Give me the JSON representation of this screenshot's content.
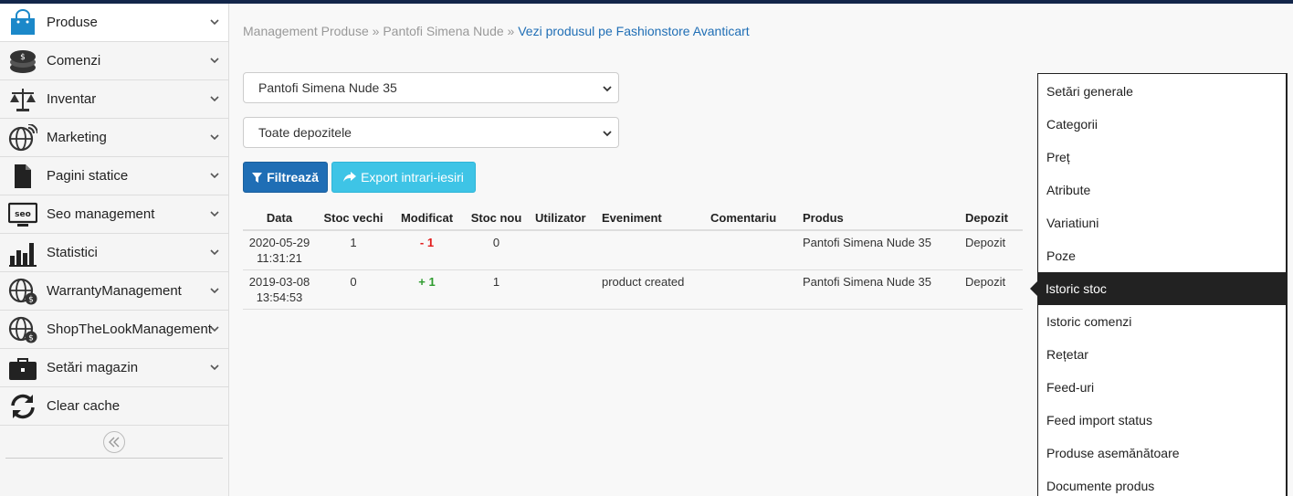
{
  "sidebar": {
    "items": [
      {
        "label": "Produse",
        "icon": "shopping-bag-icon",
        "active": true
      },
      {
        "label": "Comenzi",
        "icon": "coins-icon"
      },
      {
        "label": "Inventar",
        "icon": "scale-icon"
      },
      {
        "label": "Marketing",
        "icon": "globe-signal-icon"
      },
      {
        "label": "Pagini statice",
        "icon": "document-icon"
      },
      {
        "label": "Seo management",
        "icon": "seo-monitor-icon"
      },
      {
        "label": "Statistici",
        "icon": "bar-chart-icon"
      },
      {
        "label": "WarrantyManagement",
        "icon": "globe-dollar-icon"
      },
      {
        "label": "ShopTheLookManagement",
        "icon": "globe-dollar-icon"
      },
      {
        "label": "Setări magazin",
        "icon": "briefcase-icon"
      },
      {
        "label": "Clear cache",
        "icon": "refresh-icon"
      }
    ]
  },
  "breadcrumb": {
    "part1": "Management Produse",
    "sep": " » ",
    "part2": "Pantofi Simena Nude",
    "link": "Vezi produsul pe Fashionstore Avanticart"
  },
  "filters": {
    "product_select": "Pantofi Simena Nude 35",
    "warehouse_select": "Toate depozitele",
    "filter_label": "Filtrează",
    "export_label": "Export intrari-iesiri"
  },
  "table": {
    "headers": [
      "Data",
      "Stoc vechi",
      "Modificat",
      "Stoc nou",
      "Utilizator",
      "Eveniment",
      "Comentariu",
      "Produs",
      "Depozit"
    ],
    "rows": [
      {
        "date": "2020-05-29",
        "time": "11:31:21",
        "old": "1",
        "change": "- 1",
        "new": "0",
        "user": "",
        "event": "",
        "comment": "",
        "product": "Pantofi Simena Nude 35",
        "warehouse": "Depozit"
      },
      {
        "date": "2019-03-08",
        "time": "13:54:53",
        "old": "0",
        "change": "+ 1",
        "new": "1",
        "user": "",
        "event": "product created",
        "comment": "",
        "product": "Pantofi Simena Nude 35",
        "warehouse": "Depozit"
      }
    ]
  },
  "right_menu": {
    "items": [
      "Setări generale",
      "Categorii",
      "Preț",
      "Atribute",
      "Variatiuni",
      "Poze",
      "Istoric stoc",
      "Istoric comenzi",
      "Rețetar",
      "Feed-uri",
      "Feed import status",
      "Produse asemănătoare",
      "Documente produs"
    ],
    "active_index": 6
  },
  "colors": {
    "primary": "#1f6eb5",
    "info": "#3ec4e6",
    "negative": "#e21d1d",
    "positive": "#2e9b2e",
    "topbar": "#13264a"
  }
}
